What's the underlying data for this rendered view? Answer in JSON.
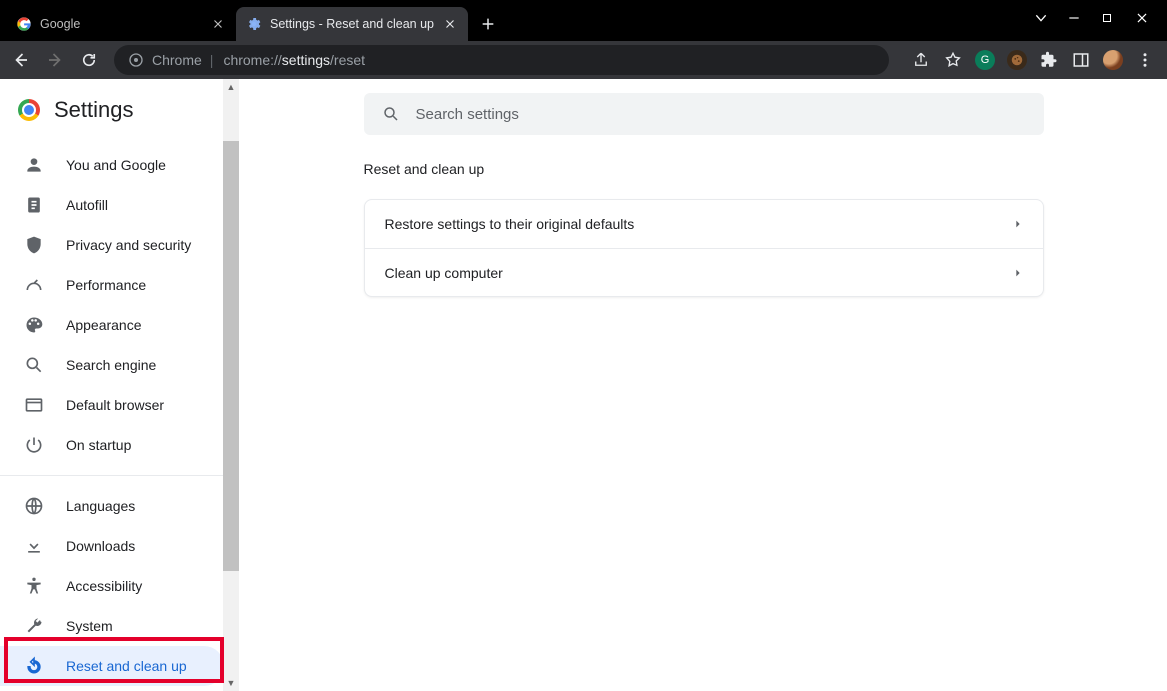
{
  "window": {
    "tabs": [
      {
        "title": "Google",
        "active": false
      },
      {
        "title": "Settings - Reset and clean up",
        "active": true
      }
    ]
  },
  "toolbar": {
    "secure_label": "Chrome",
    "url_display_prefix": "chrome://",
    "url_display_bold": "settings",
    "url_display_suffix": "/reset"
  },
  "settings": {
    "title": "Settings",
    "search_placeholder": "Search settings",
    "nav_group1": [
      {
        "icon": "person-icon",
        "label": "You and Google"
      },
      {
        "icon": "autofill-icon",
        "label": "Autofill"
      },
      {
        "icon": "shield-icon",
        "label": "Privacy and security"
      },
      {
        "icon": "performance-icon",
        "label": "Performance"
      },
      {
        "icon": "palette-icon",
        "label": "Appearance"
      },
      {
        "icon": "search-icon",
        "label": "Search engine"
      },
      {
        "icon": "browser-icon",
        "label": "Default browser"
      },
      {
        "icon": "power-icon",
        "label": "On startup"
      }
    ],
    "nav_group2": [
      {
        "icon": "globe-icon",
        "label": "Languages"
      },
      {
        "icon": "download-icon",
        "label": "Downloads"
      },
      {
        "icon": "accessibility-icon",
        "label": "Accessibility"
      },
      {
        "icon": "wrench-icon",
        "label": "System"
      },
      {
        "icon": "reset-icon",
        "label": "Reset and clean up",
        "selected": true
      }
    ],
    "section_title": "Reset and clean up",
    "rows": [
      "Restore settings to their original defaults",
      "Clean up computer"
    ]
  }
}
